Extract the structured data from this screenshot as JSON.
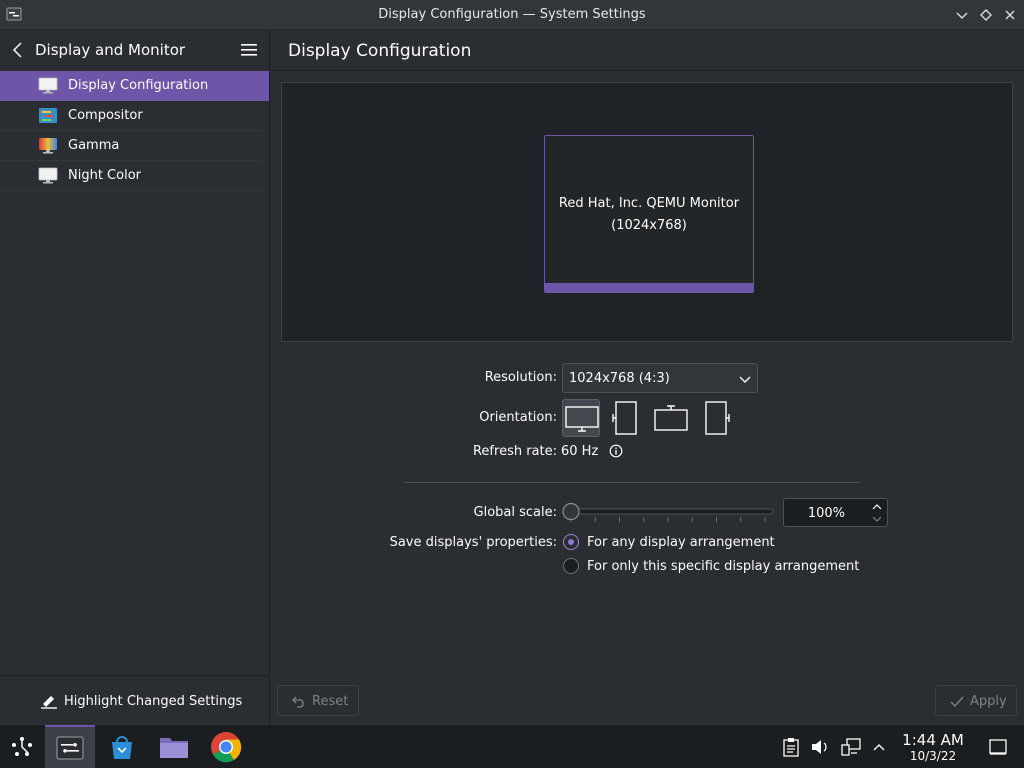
{
  "window": {
    "title": "Display Configuration — System Settings"
  },
  "sidebar": {
    "title": "Display and Monitor",
    "items": [
      {
        "label": "Display Configuration",
        "icon": "monitor-icon",
        "active": true
      },
      {
        "label": "Compositor",
        "icon": "compositor-icon",
        "active": false
      },
      {
        "label": "Gamma",
        "icon": "gamma-icon",
        "active": false
      },
      {
        "label": "Night Color",
        "icon": "night-color-icon",
        "active": false
      }
    ],
    "footer_label": "Highlight Changed Settings"
  },
  "main": {
    "title": "Display Configuration",
    "monitor": {
      "name": "Red Hat, Inc. QEMU Monitor",
      "resolution": "(1024x768)"
    },
    "resolution_label": "Resolution:",
    "resolution_value": "1024x768 (4:3)",
    "orientation_label": "Orientation:",
    "orientation_options": [
      "landscape",
      "portrait-left",
      "landscape-flipped",
      "portrait-right"
    ],
    "orientation_selected": 0,
    "refresh_label": "Refresh rate:",
    "refresh_value": "60 Hz",
    "scale_label": "Global scale:",
    "scale_value": "100%",
    "scale_fraction": 0.0,
    "save_label": "Save displays' properties:",
    "save_options": [
      {
        "label": "For any display arrangement",
        "checked": true
      },
      {
        "label": "For only this specific display arrangement",
        "checked": false
      }
    ],
    "reset_label": "Reset",
    "apply_label": "Apply"
  },
  "taskbar": {
    "time": "1:44 AM",
    "date": "10/3/22"
  },
  "colors": {
    "accent": "#6d56a8",
    "background": "#2a2e32",
    "taskbar": "#1b1e20"
  }
}
